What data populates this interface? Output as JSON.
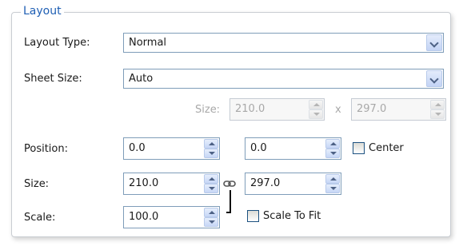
{
  "group": {
    "title": "Layout"
  },
  "layout_type": {
    "label": "Layout Type:",
    "value": "Normal"
  },
  "sheet_size": {
    "label": "Sheet Size:",
    "value": "Auto",
    "size_label": "Size:",
    "width": "210.0",
    "separator": "x",
    "height": "297.0"
  },
  "position": {
    "label": "Position:",
    "x": "0.0",
    "y": "0.0",
    "center_label": "Center",
    "center_checked": false
  },
  "size": {
    "label": "Size:",
    "width": "210.0",
    "height": "297.0"
  },
  "scale": {
    "label": "Scale:",
    "value": "100.0",
    "fit_label": "Scale To Fit",
    "fit_checked": false
  },
  "icons": [
    "chevron-down-icon",
    "spin-up-icon",
    "spin-down-icon",
    "chain-link-icon"
  ]
}
